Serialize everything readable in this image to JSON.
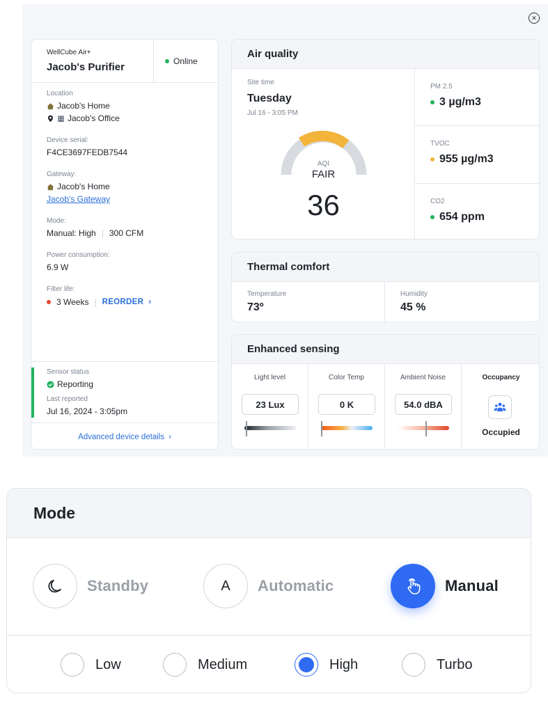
{
  "device": {
    "model": "WellCube Air+",
    "name": "Jacob's Purifier",
    "status": "Online",
    "location_label": "Location",
    "location_home": "Jacob's Home",
    "location_office": "Jacob's Office",
    "serial_label": "Device serial:",
    "serial": "F4CE3697FEDB7544",
    "gateway_label": "Gateway:",
    "gateway_home": "Jacob's Home",
    "gateway_link": "Jacob's Gateway",
    "mode_label": "Mode:",
    "mode_value": "Manual: High",
    "mode_cfm": "300 CFM",
    "power_label": "Power consumption:",
    "power_value": "6.9 W",
    "filter_label": "Filter life:",
    "filter_value": "3 Weeks",
    "reorder": "REORDER",
    "sensor_status_label": "Sensor status",
    "sensor_status": "Reporting",
    "last_reported_label": "Last reported",
    "last_reported": "Jul 16, 2024 - 3:05pm",
    "advanced": "Advanced device details"
  },
  "air_quality": {
    "title": "Air quality",
    "site_time_label": "Site time",
    "day": "Tuesday",
    "date": "Jul 16 - 3:05 PM",
    "aqi_label": "AQI",
    "aqi_category": "FAIR",
    "aqi_value": "36",
    "metrics": [
      {
        "label": "PM 2.5",
        "value": "3 µg/m3",
        "color": "#22b35e"
      },
      {
        "label": "TVOC",
        "value": "955 µg/m3",
        "color": "#f3b43b"
      },
      {
        "label": "CO2",
        "value": "654 ppm",
        "color": "#22b35e"
      }
    ]
  },
  "thermal": {
    "title": "Thermal comfort",
    "temp_label": "Temperature",
    "temp_value": "73º",
    "humidity_label": "Humidity",
    "humidity_value": "45 %"
  },
  "enhanced": {
    "title": "Enhanced sensing",
    "light_label": "Light level",
    "light_value": "23 Lux",
    "color_label": "Color Temp",
    "color_value": "0 K",
    "noise_label": "Ambient Noise",
    "noise_value": "54.0 dBA",
    "occupancy_label": "Occupancy",
    "occupancy_value": "Occupied"
  },
  "mode_panel": {
    "title": "Mode",
    "options": [
      {
        "label": "Standby",
        "icon": "moon-icon",
        "active": false
      },
      {
        "label": "Automatic",
        "icon": "letter-a-icon",
        "glyph": "A",
        "active": false
      },
      {
        "label": "Manual",
        "icon": "hand-pointer-icon",
        "active": true
      }
    ],
    "speeds": [
      {
        "label": "Low",
        "checked": false
      },
      {
        "label": "Medium",
        "checked": false
      },
      {
        "label": "High",
        "checked": true
      },
      {
        "label": "Turbo",
        "checked": false
      }
    ]
  },
  "colors": {
    "accent": "#2f6bf2",
    "link": "#2a6fd6",
    "online_green": "#22b35e",
    "filter_red": "#e5482d",
    "gauge_yellow": "#f3b43b",
    "gauge_grey": "#d7dbe0"
  }
}
